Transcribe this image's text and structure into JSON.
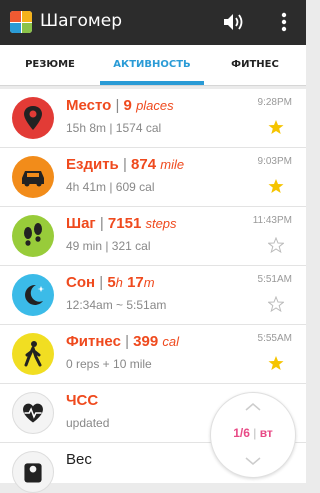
{
  "app": {
    "title": "Шагомер"
  },
  "colors": {
    "accent": "#2a9bd6",
    "title_text": "#ef4a1e",
    "star": "#f5c400"
  },
  "tabs": [
    {
      "label": "РЕЗЮМЕ"
    },
    {
      "label": "АКТИВНОСТЬ",
      "active": true
    },
    {
      "label": "ФИТНЕС"
    }
  ],
  "rows": [
    {
      "name": "Место",
      "num": "9",
      "unit": "places",
      "sub": "15h 8m  |  1574 cal",
      "time": "9:28PM",
      "starred": true,
      "icon": "location-pin-icon",
      "color": "#e23b36"
    },
    {
      "name": "Ездить",
      "num": "874",
      "unit": "mile",
      "sub": "4h 41m  |  609 cal",
      "time": "9:03PM",
      "starred": true,
      "icon": "car-icon",
      "color": "#f28c1a"
    },
    {
      "name": "Шаг",
      "num": "7151",
      "unit": "steps",
      "sub": "49 min  |  321 cal",
      "time": "11:43PM",
      "starred": false,
      "icon": "footsteps-icon",
      "color": "#98cc3a"
    },
    {
      "name": "Сон",
      "num": "5",
      "unit": "h",
      "num2": "17",
      "unit2": "m",
      "sub": "12:34am ~ 5:51am",
      "time": "5:51AM",
      "starred": false,
      "icon": "moon-icon",
      "color": "#3bbbe8"
    },
    {
      "name": "Фитнес",
      "num": "399",
      "unit": "cal",
      "sub": "0 reps + 10 mile",
      "time": "5:55AM",
      "starred": true,
      "icon": "walking-person-icon",
      "color": "#f1de22"
    },
    {
      "name": "ЧСС",
      "sub": "updated",
      "icon": "heart-rate-icon",
      "color": "#f4f4f4"
    },
    {
      "name": "Вес",
      "icon": "scale-icon",
      "color": "#f4f4f4"
    }
  ],
  "pager": {
    "current": "1/6",
    "day": "вт"
  }
}
